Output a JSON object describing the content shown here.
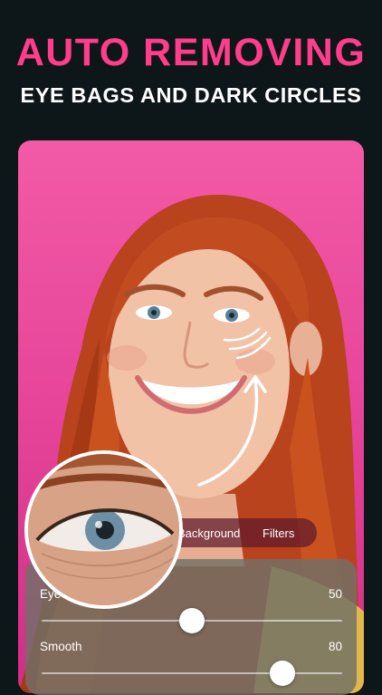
{
  "headline": "AUTO REMOVING",
  "subheadline": "EYE BAGS AND DARK CIRCLES",
  "tabs": [
    {
      "label": "Background"
    },
    {
      "label": "Filters"
    }
  ],
  "adjustments": [
    {
      "label": "Eye Bags",
      "value": "50",
      "level": 0.5
    },
    {
      "label": "Smooth",
      "value": "80",
      "level": 0.8
    }
  ],
  "colors": {
    "headline": "#ff3d8b",
    "background": "#0d1618",
    "photo_backdrop": "#e7469a",
    "panel": "#707068"
  }
}
